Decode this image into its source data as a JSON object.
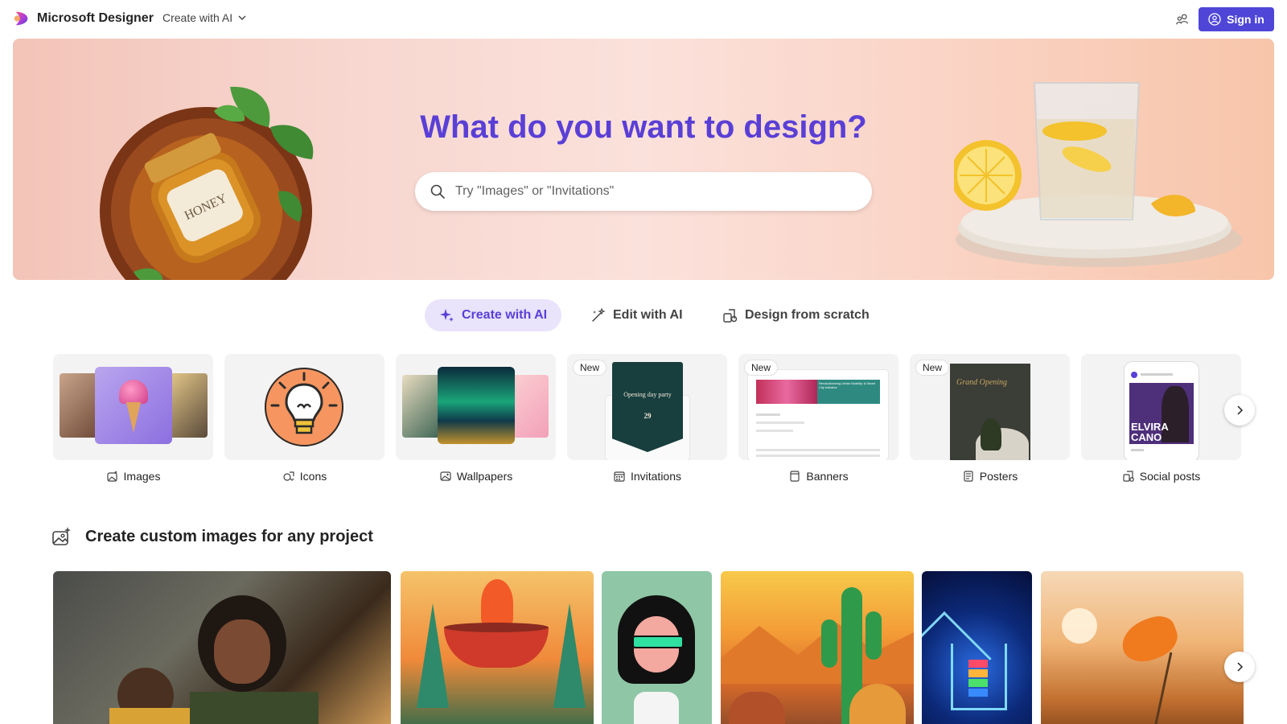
{
  "header": {
    "app_name": "Microsoft Designer",
    "menu_label": "Create with AI",
    "signin_label": "Sign in",
    "accent": "#4f46d8"
  },
  "hero": {
    "title": "What do you want to design?",
    "search_placeholder": "Try \"Images\" or \"Invitations\"",
    "title_color": "#5a3fd6"
  },
  "modes": [
    {
      "label": "Create with AI",
      "icon": "sparkle-icon",
      "active": true
    },
    {
      "label": "Edit with AI",
      "icon": "magic-wand-icon",
      "active": false
    },
    {
      "label": "Design from scratch",
      "icon": "shapes-icon",
      "active": false
    }
  ],
  "categories": [
    {
      "label": "Images",
      "icon": "image-sparkle-icon",
      "badge": ""
    },
    {
      "label": "Icons",
      "icon": "icon-shapes-icon",
      "badge": ""
    },
    {
      "label": "Wallpapers",
      "icon": "wallpaper-icon",
      "badge": ""
    },
    {
      "label": "Invitations",
      "icon": "calendar-icon",
      "badge": "New",
      "thumb_text": "Opening day party",
      "thumb_date": "29"
    },
    {
      "label": "Banners",
      "icon": "banner-icon",
      "badge": "New",
      "thumb_text": "Revolutionizing Urban Mobility: A Smart City Initiative"
    },
    {
      "label": "Posters",
      "icon": "poster-icon",
      "badge": "New",
      "thumb_text": "Grand Opening"
    },
    {
      "label": "Social posts",
      "icon": "social-post-icon",
      "badge": "",
      "thumb_text": "ELVIRA CANO"
    }
  ],
  "section": {
    "title": "Create custom images for any project"
  }
}
